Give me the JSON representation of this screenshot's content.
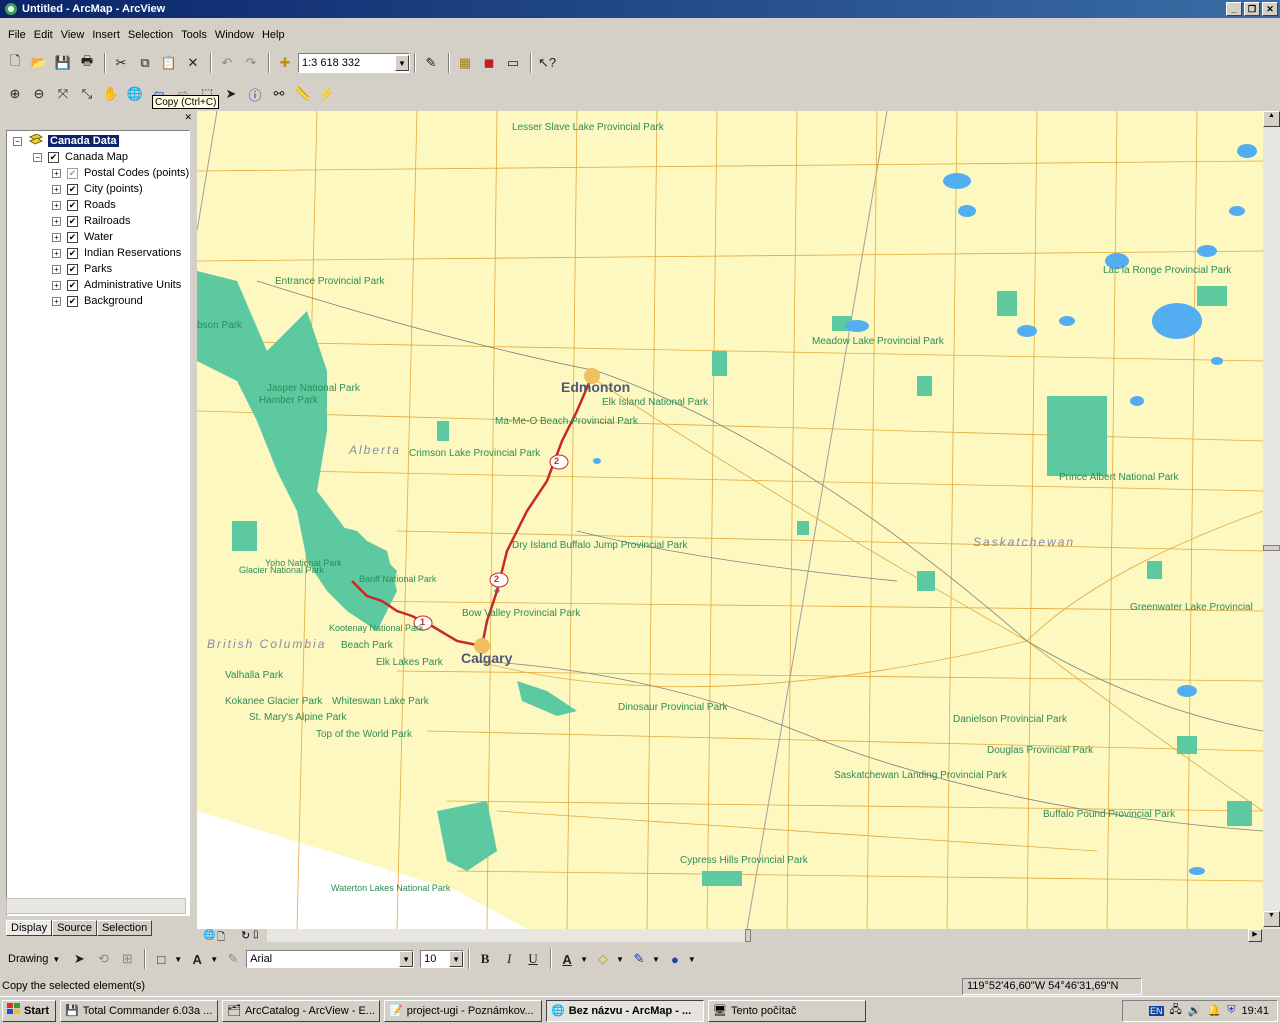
{
  "window": {
    "title": "Untitled - ArcMap - ArcView"
  },
  "menu": [
    "File",
    "Edit",
    "View",
    "Insert",
    "Selection",
    "Tools",
    "Window",
    "Help"
  ],
  "toolbar": {
    "scale": "1:3 618 332"
  },
  "tooltip": "Copy (Ctrl+C)",
  "toc": {
    "frame": "Canada Data",
    "map": "Canada Map",
    "layers": [
      {
        "name": "Postal Codes (points)",
        "checked": "partial"
      },
      {
        "name": "City (points)",
        "checked": "yes"
      },
      {
        "name": "Roads",
        "checked": "yes"
      },
      {
        "name": "Railroads",
        "checked": "yes"
      },
      {
        "name": "Water",
        "checked": "yes"
      },
      {
        "name": "Indian Reservations",
        "checked": "yes"
      },
      {
        "name": "Parks",
        "checked": "yes"
      },
      {
        "name": "Administrative Units",
        "checked": "yes"
      },
      {
        "name": "Background",
        "checked": "yes"
      }
    ],
    "tabs": [
      "Display",
      "Source",
      "Selection"
    ]
  },
  "map": {
    "cities": [
      "Edmonton",
      "Calgary"
    ],
    "provinces": [
      "Alberta",
      "British Columbia",
      "Saskatchewan"
    ],
    "parks": [
      "Lesser Slave Lake Provincial Park",
      "Entrance Provincial Park",
      "bson Park",
      "Jasper National Park",
      "Hamber Park",
      "Meadow Lake Provincial Park",
      "Lac la Ronge Provincial Park",
      "Elk Island National Park",
      "Ma-Me-O Beach Provincial Park",
      "Crimson Lake Provincial Park",
      "Prince Albert National Park",
      "Dry Island Buffalo Jump Provincial Park",
      "Yoho National Park",
      "Glacier National Park",
      "Banff National Park",
      "Bow Valley Provincial Park",
      "Kootenay National Park",
      "Beach Park",
      "Elk Lakes Park",
      "Greenwater Lake Provincial",
      "Valhalla Park",
      "Kokanee Glacier Park",
      "Whiteswan Lake Park",
      "St. Mary's Alpine Park",
      "Top of the World Park",
      "Dinosaur Provincial Park",
      "Danielson Provincial Park",
      "Douglas Provincial Park",
      "Saskatchewan Landing Provincial Park",
      "Buffalo Pound Provincial Park",
      "Cypress Hills Provincial Park",
      "Waterton Lakes National Park"
    ],
    "highway_shields": [
      "2",
      "2",
      "1"
    ],
    "colors": {
      "land": "#fcf8c0",
      "park": "#5dc9a0",
      "water": "#52aef0",
      "road": "#e0a030",
      "highway": "#c82828"
    }
  },
  "drawing": {
    "label": "Drawing",
    "font": "Arial",
    "size": "10"
  },
  "status": {
    "text": "Copy the selected element(s)",
    "coords": "119°52'46,60\"W  54°46'31,69\"N"
  },
  "taskbar": {
    "start": "Start",
    "tasks": [
      "Total Commander 6.03a ...",
      "ArcCatalog - ArcView - E...",
      "project-ugi - Poznámkov...",
      "Bez názvu - ArcMap - ...",
      "Tento počítač"
    ],
    "active_index": 3,
    "tray_lang": "EN",
    "time": "19:41"
  }
}
